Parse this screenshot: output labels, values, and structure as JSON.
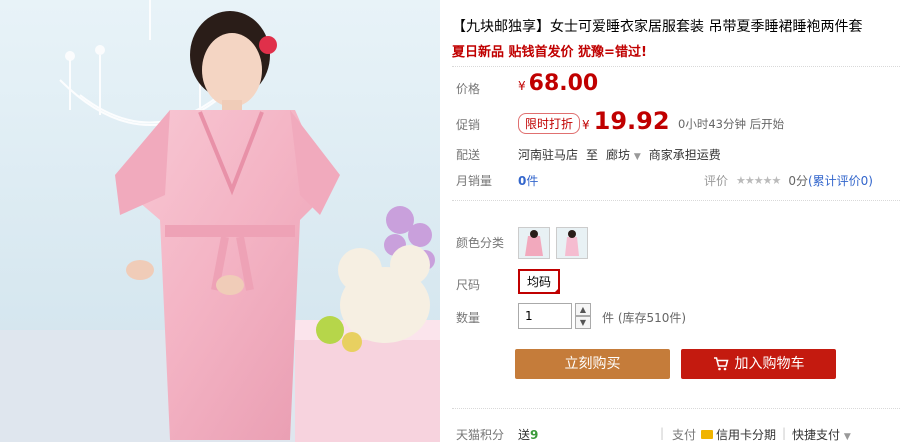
{
  "product": {
    "title": "【九块邮独享】女士可爱睡衣家居服套装 吊带夏季睡裙睡袍两件套",
    "subtitle": "夏日新品 贴钱首发价 犹豫=错过!"
  },
  "price": {
    "label": "价格",
    "currency": "¥",
    "value": "68.00"
  },
  "promo": {
    "label": "促销",
    "badge": "限时打折",
    "currency": "¥",
    "value": "19.92",
    "countdown": "0小时43分钟 后开始"
  },
  "shipping": {
    "label": "配送",
    "origin": "河南驻马店",
    "to": "至",
    "destination": "廊坊",
    "note": "商家承担运费"
  },
  "sales": {
    "label": "月销量",
    "value": "0",
    "unit": "件",
    "rating_label": "评价",
    "rating_stars": "★★★★★",
    "rating_score": "0分",
    "rating_count": "(累计评价0)"
  },
  "color": {
    "label": "颜色分类"
  },
  "size": {
    "label": "尺码",
    "selected": "均码"
  },
  "quantity": {
    "label": "数量",
    "value": "1",
    "stock": "件 (库存510件)"
  },
  "buttons": {
    "buy": "立刻购买",
    "cart": "加入购物车"
  },
  "footer": {
    "points_label": "天猫积分",
    "points_prefix": "送",
    "points_value": "9",
    "pay_label": "支付",
    "credit": "信用卡分期",
    "quick": "快捷支付"
  },
  "colors": {
    "accent": "#c00000",
    "buy_button": "#c57c3a",
    "cart_button": "#c41a0f",
    "link": "#3366cc"
  }
}
